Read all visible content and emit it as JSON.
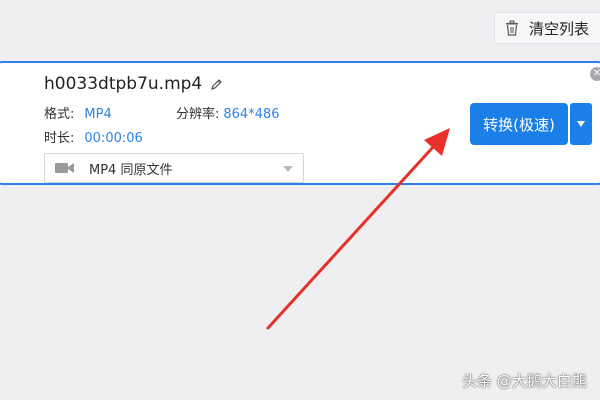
{
  "toolbar": {
    "clear_list_label": "清空列表",
    "clear_icon": "trash-icon"
  },
  "file": {
    "name": "h0033dtpb7u.mp4",
    "format_label": "格式:",
    "format_value": "MP4",
    "resolution_label": "分辨率:",
    "resolution_value": "864*486",
    "duration_label": "时长:",
    "duration_value": "00:00:06",
    "output_format": "MP4  同原文件"
  },
  "actions": {
    "convert_label": "转换(极速)"
  },
  "watermark": "头条 @大鹅大白熊",
  "colors": {
    "accent": "#1a7fe6",
    "border": "#2f7fe8",
    "arrow": "#e8302a"
  }
}
